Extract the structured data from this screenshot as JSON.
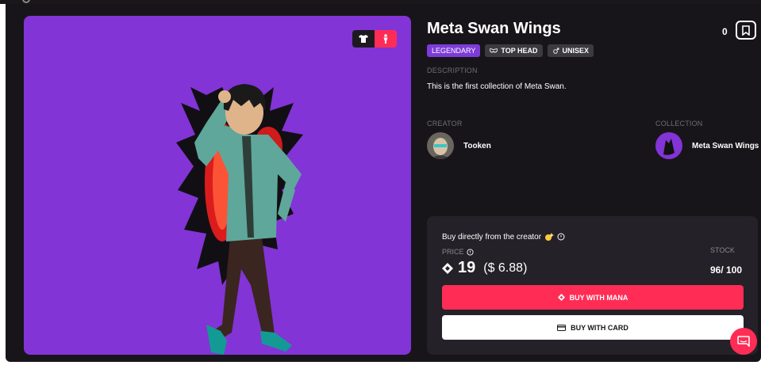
{
  "item": {
    "title": "Meta Swan Wings",
    "likes": "0",
    "tags": {
      "rarity": "LEGENDARY",
      "category": "TOP HEAD",
      "gender": "UNISEX"
    },
    "description_label": "DESCRIPTION",
    "description": "This is the first collection of Meta Swan."
  },
  "creator": {
    "label": "CREATOR",
    "name": "Tooken"
  },
  "collection": {
    "label": "COLLECTION",
    "name": "Meta Swan Wings"
  },
  "buy": {
    "text": "Buy directly from the creator",
    "price_label": "PRICE",
    "price": "19",
    "price_usd": "($ 6.88)",
    "stock_label": "STOCK",
    "stock": "96/ 100",
    "mana_button": "BUY WITH MANA",
    "card_button": "BUY WITH CARD"
  },
  "icons": {
    "preview_toggle": [
      "shirt-icon",
      "person-icon"
    ],
    "bookmark": "bookmark-icon",
    "chat": "chat-icon",
    "mana": "mana-diamond-icon",
    "card": "credit-card-icon"
  },
  "colors": {
    "accent": "#ff2d55",
    "preview_bg": "#8234d6",
    "panel_bg": "#18151a",
    "legendary": "#7d3cd9"
  }
}
